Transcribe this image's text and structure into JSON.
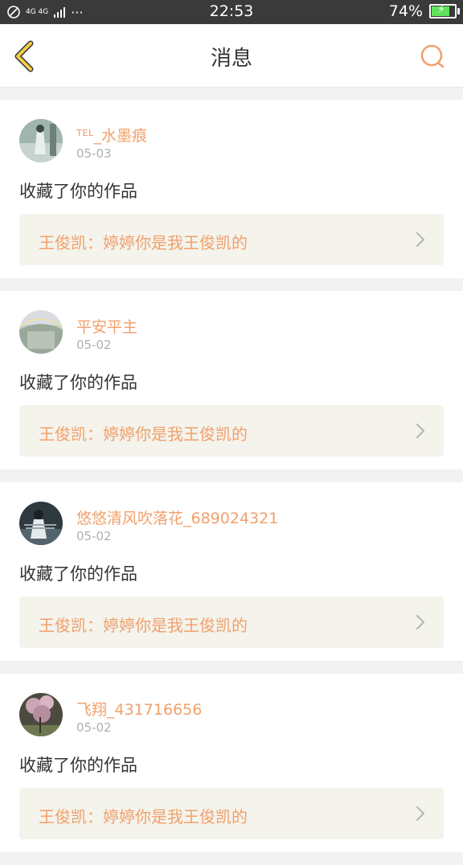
{
  "status_bar": {
    "network": "4G 4G",
    "dots": "···",
    "time": "22:53",
    "battery": "74%",
    "battery_fraction": 0.74
  },
  "header": {
    "title": "消息",
    "back_icon": "chevron-left-icon",
    "search_icon": "search-icon"
  },
  "colors": {
    "accent": "#f2a06b",
    "back_yellow": "#f4cc45",
    "box_bg": "#f4f3ec"
  },
  "messages": [
    {
      "user": "ᵀᴱᴸ_水墨痕",
      "date": "05-03",
      "action": "收藏了你的作品",
      "work": "王俊凯：婷婷你是我王俊凯的"
    },
    {
      "user": "平安平主",
      "date": "05-02",
      "action": "收藏了你的作品",
      "work": "王俊凯：婷婷你是我王俊凯的"
    },
    {
      "user": "悠悠清风吹落花_689024321",
      "date": "05-02",
      "action": "收藏了你的作品",
      "work": "王俊凯：婷婷你是我王俊凯的"
    },
    {
      "user": "飞翔_431716656",
      "date": "05-02",
      "action": "收藏了你的作品",
      "work": "王俊凯：婷婷你是我王俊凯的"
    }
  ]
}
